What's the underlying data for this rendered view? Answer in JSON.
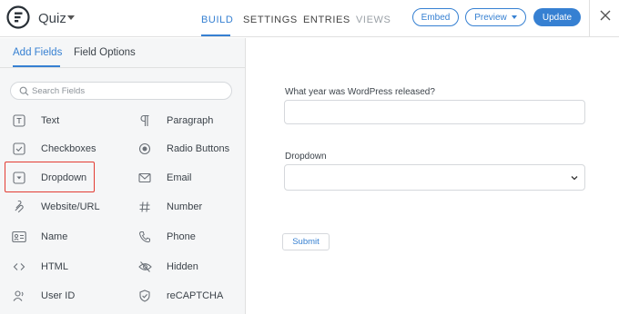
{
  "header": {
    "form_title": "Quiz",
    "nav": [
      {
        "label": "BUILD"
      },
      {
        "label": "SETTINGS"
      },
      {
        "label": "ENTRIES"
      },
      {
        "label": "VIEWS"
      }
    ],
    "embed_label": "Embed",
    "preview_label": "Preview",
    "update_label": "Update"
  },
  "sidebar": {
    "tabs": [
      {
        "label": "Add Fields"
      },
      {
        "label": "Field Options"
      }
    ],
    "search_placeholder": "Search Fields",
    "fields_left": [
      {
        "label": "Text",
        "icon": "text-icon"
      },
      {
        "label": "Checkboxes",
        "icon": "checkbox-icon"
      },
      {
        "label": "Dropdown",
        "icon": "dropdown-icon"
      },
      {
        "label": "Website/URL",
        "icon": "link-icon"
      },
      {
        "label": "Name",
        "icon": "name-card-icon"
      },
      {
        "label": "HTML",
        "icon": "code-icon"
      },
      {
        "label": "User ID",
        "icon": "user-icon"
      }
    ],
    "fields_right": [
      {
        "label": "Paragraph",
        "icon": "paragraph-icon"
      },
      {
        "label": "Radio Buttons",
        "icon": "radio-icon"
      },
      {
        "label": "Email",
        "icon": "email-icon"
      },
      {
        "label": "Number",
        "icon": "hash-icon"
      },
      {
        "label": "Phone",
        "icon": "phone-icon"
      },
      {
        "label": "Hidden",
        "icon": "eye-slash-icon"
      },
      {
        "label": "reCAPTCHA",
        "icon": "shield-check-icon"
      }
    ]
  },
  "form": {
    "question1_label": "What year was WordPress released?",
    "question1_value": "",
    "question2_label": "Dropdown",
    "question2_value": "",
    "submit_label": "Submit"
  },
  "colors": {
    "accent": "#3680d2",
    "highlight": "#e33b32",
    "sidebar_bg": "#f5f6f7"
  }
}
